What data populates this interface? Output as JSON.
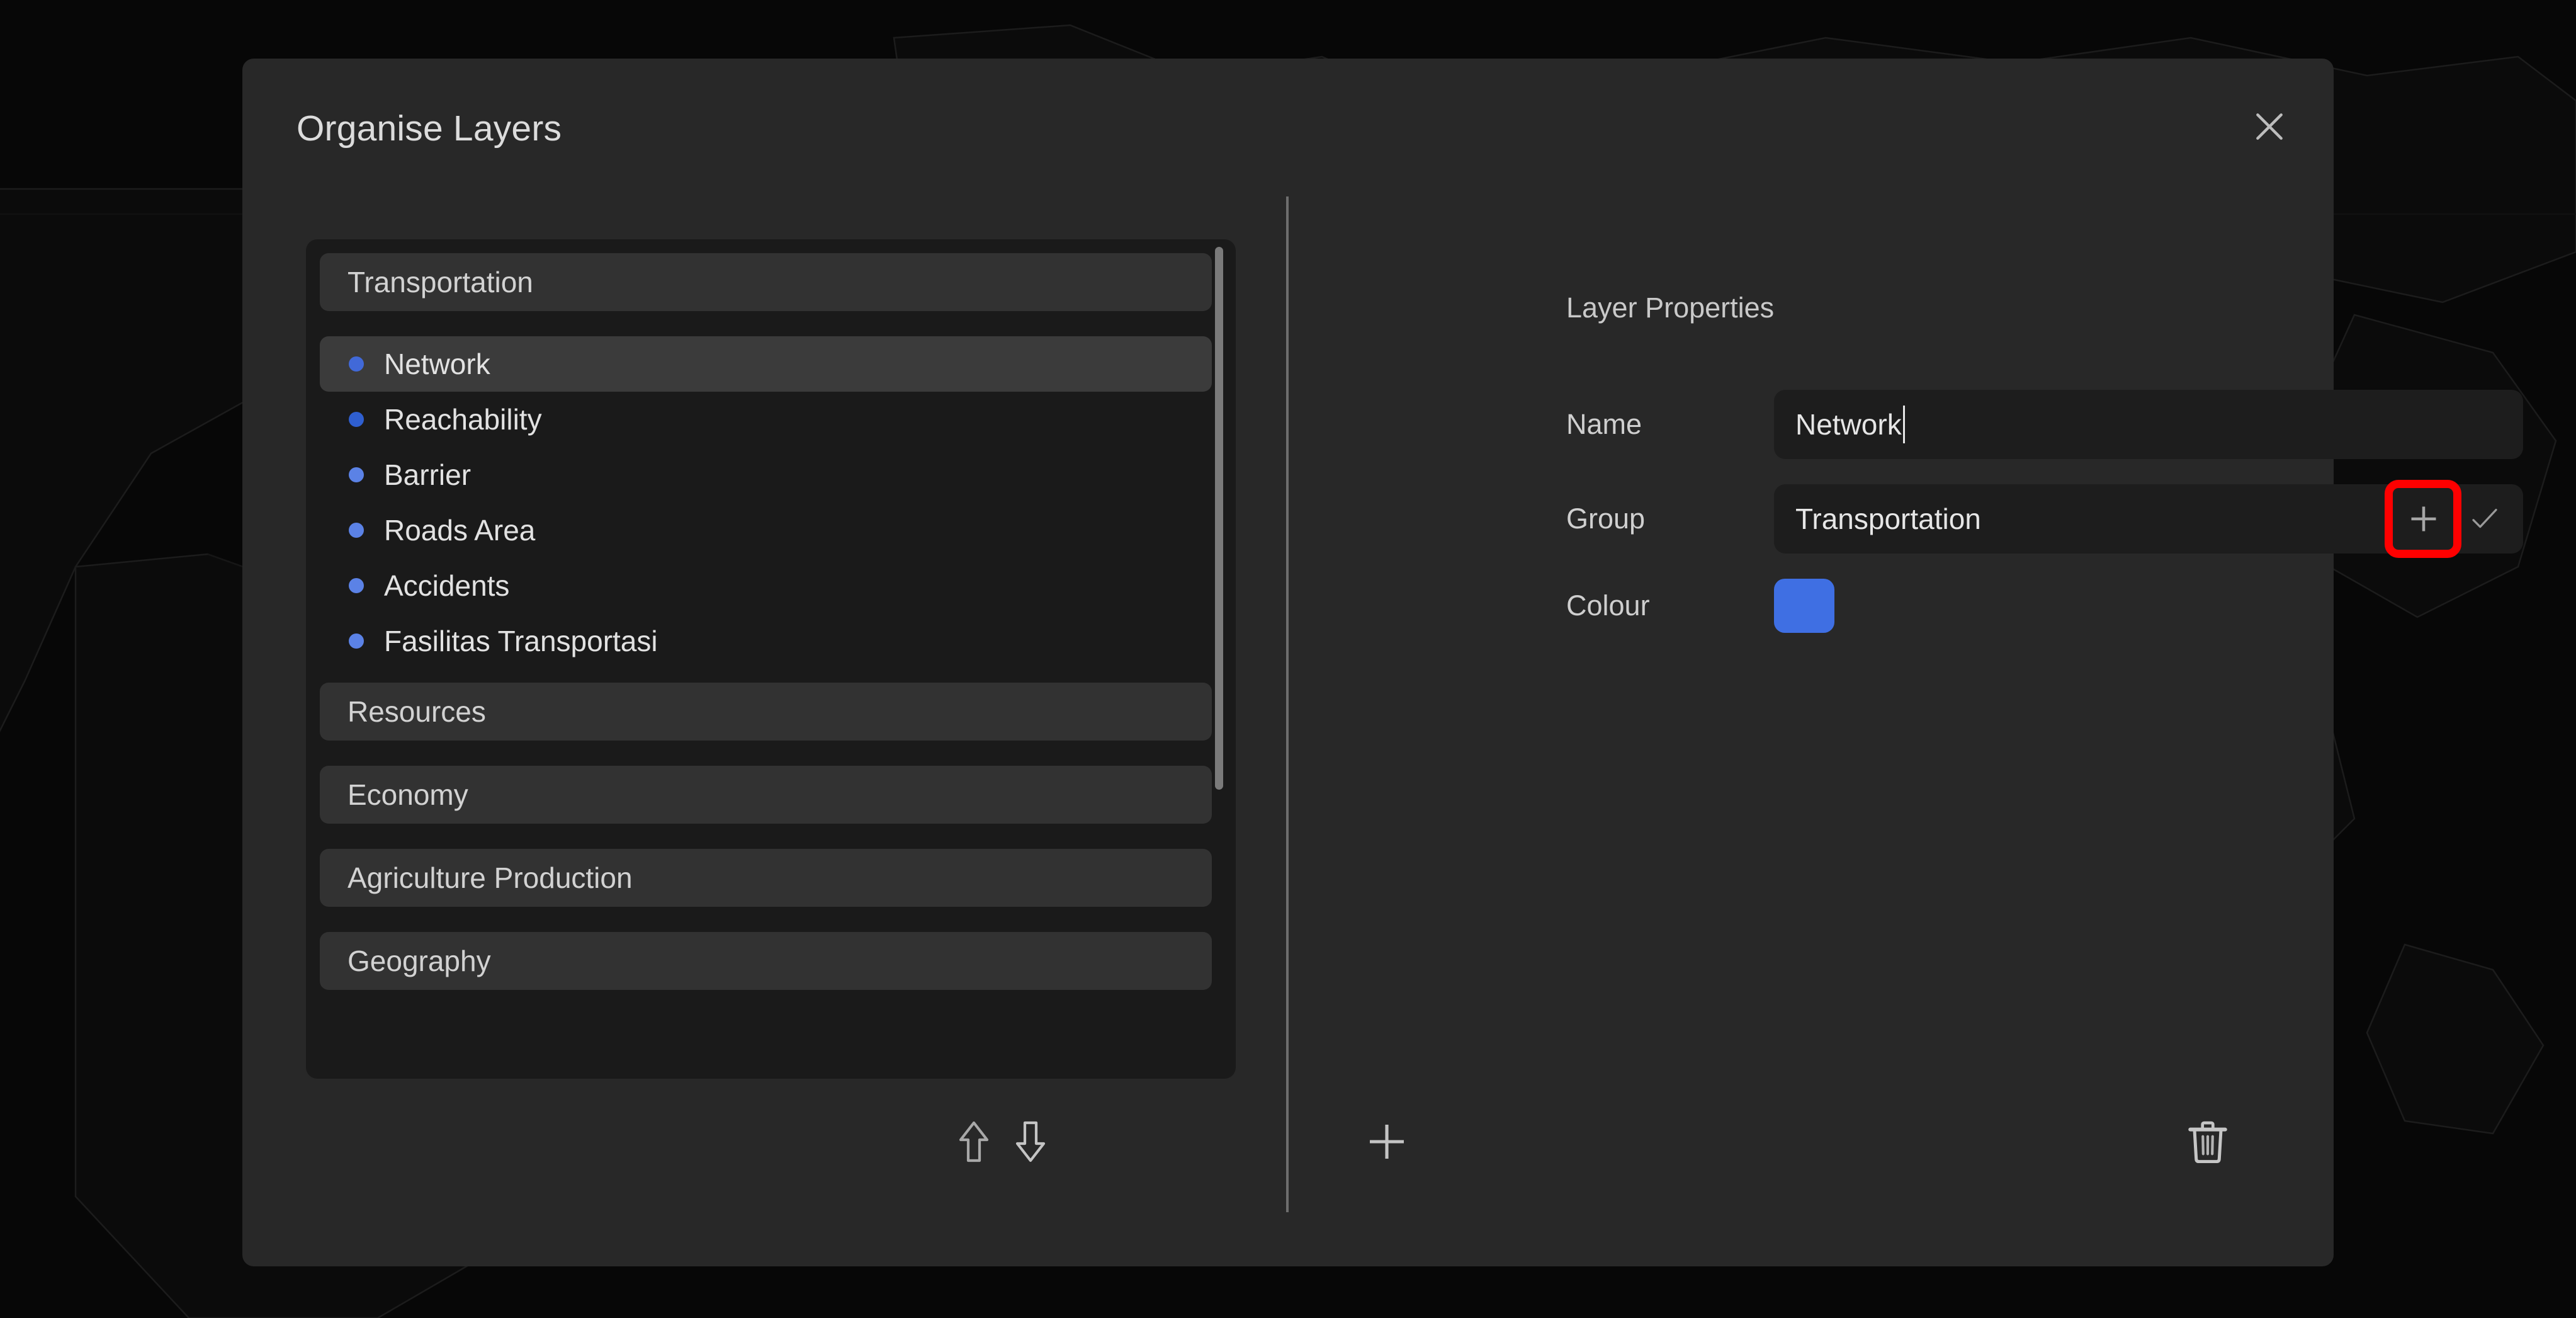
{
  "dialog": {
    "title": "Organise Layers",
    "close_icon": "close-icon"
  },
  "layer_list": {
    "groups": [
      {
        "name": "Transportation",
        "expanded": true,
        "layers": [
          {
            "name": "Network",
            "colour": "#4169d8",
            "selected": true
          },
          {
            "name": "Reachability",
            "colour": "#2f5fd0",
            "selected": false
          },
          {
            "name": "Barrier",
            "colour": "#5b82e6",
            "selected": false
          },
          {
            "name": "Roads Area",
            "colour": "#5b82e6",
            "selected": false
          },
          {
            "name": "Accidents",
            "colour": "#5b82e6",
            "selected": false
          },
          {
            "name": "Fasilitas Transportasi",
            "colour": "#5b82e6",
            "selected": false
          }
        ]
      },
      {
        "name": "Resources",
        "expanded": false,
        "layers": []
      },
      {
        "name": "Economy",
        "expanded": false,
        "layers": []
      },
      {
        "name": "Agriculture Production",
        "expanded": false,
        "layers": []
      },
      {
        "name": "Geography",
        "expanded": false,
        "layers": []
      }
    ]
  },
  "left_toolbar": {
    "move_up_icon": "arrow-up-icon",
    "move_down_icon": "arrow-down-icon",
    "add_icon": "plus-icon"
  },
  "layer_properties": {
    "heading": "Layer Properties",
    "name_label": "Name",
    "name_value": "Network",
    "group_label": "Group",
    "group_value": "Transportation",
    "colour_label": "Colour",
    "colour_value": "#3f6fe3",
    "add_group_icon": "plus-icon",
    "confirm_group_icon": "check-icon",
    "delete_icon": "trash-icon",
    "highlight_colour": "#ff0000"
  }
}
